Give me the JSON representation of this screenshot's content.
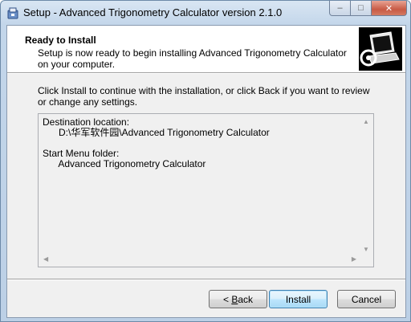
{
  "window": {
    "title": "Setup - Advanced Trigonometry Calculator version 2.1.0",
    "caption_min": "–",
    "caption_max": "□",
    "caption_close": "✕"
  },
  "header": {
    "title": "Ready to Install",
    "subtitle": "Setup is now ready to begin installing Advanced Trigonometry Calculator on your computer."
  },
  "body": {
    "instruction": "Click Install to continue with the installation, or click Back if you want to review or change any settings."
  },
  "summary": {
    "lines": [
      "Destination location:",
      "      D:\\华军软件园\\Advanced Trigonometry Calculator",
      "",
      "Start Menu folder:",
      "      Advanced Trigonometry Calculator"
    ]
  },
  "buttons": {
    "back_prefix": "< ",
    "back_accel": "B",
    "back_rest": "ack",
    "install": "Install",
    "cancel": "Cancel"
  },
  "icons": {
    "app": "setup-icon",
    "wizard": "computer-install-icon"
  }
}
